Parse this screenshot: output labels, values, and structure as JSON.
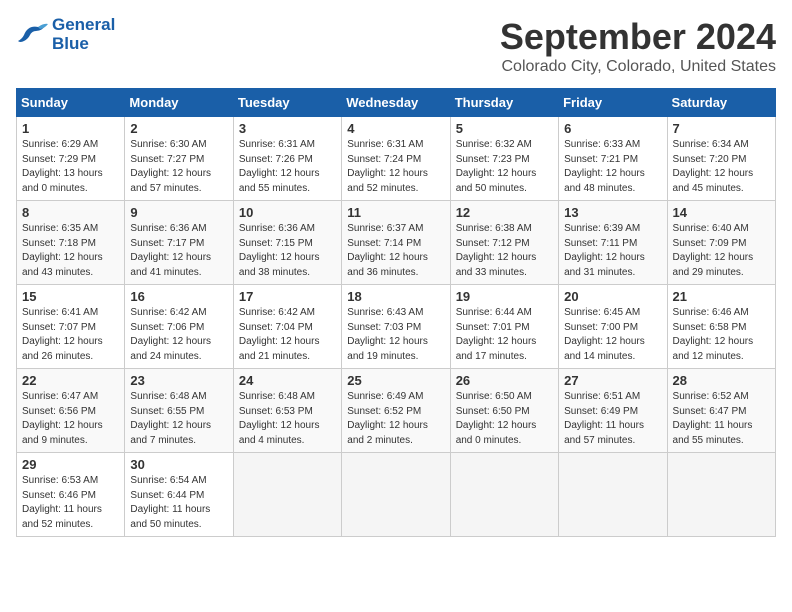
{
  "logo": {
    "line1": "General",
    "line2": "Blue"
  },
  "title": "September 2024",
  "location": "Colorado City, Colorado, United States",
  "days_of_week": [
    "Sunday",
    "Monday",
    "Tuesday",
    "Wednesday",
    "Thursday",
    "Friday",
    "Saturday"
  ],
  "weeks": [
    [
      {
        "day": "1",
        "info": "Sunrise: 6:29 AM\nSunset: 7:29 PM\nDaylight: 13 hours\nand 0 minutes."
      },
      {
        "day": "2",
        "info": "Sunrise: 6:30 AM\nSunset: 7:27 PM\nDaylight: 12 hours\nand 57 minutes."
      },
      {
        "day": "3",
        "info": "Sunrise: 6:31 AM\nSunset: 7:26 PM\nDaylight: 12 hours\nand 55 minutes."
      },
      {
        "day": "4",
        "info": "Sunrise: 6:31 AM\nSunset: 7:24 PM\nDaylight: 12 hours\nand 52 minutes."
      },
      {
        "day": "5",
        "info": "Sunrise: 6:32 AM\nSunset: 7:23 PM\nDaylight: 12 hours\nand 50 minutes."
      },
      {
        "day": "6",
        "info": "Sunrise: 6:33 AM\nSunset: 7:21 PM\nDaylight: 12 hours\nand 48 minutes."
      },
      {
        "day": "7",
        "info": "Sunrise: 6:34 AM\nSunset: 7:20 PM\nDaylight: 12 hours\nand 45 minutes."
      }
    ],
    [
      {
        "day": "8",
        "info": "Sunrise: 6:35 AM\nSunset: 7:18 PM\nDaylight: 12 hours\nand 43 minutes."
      },
      {
        "day": "9",
        "info": "Sunrise: 6:36 AM\nSunset: 7:17 PM\nDaylight: 12 hours\nand 41 minutes."
      },
      {
        "day": "10",
        "info": "Sunrise: 6:36 AM\nSunset: 7:15 PM\nDaylight: 12 hours\nand 38 minutes."
      },
      {
        "day": "11",
        "info": "Sunrise: 6:37 AM\nSunset: 7:14 PM\nDaylight: 12 hours\nand 36 minutes."
      },
      {
        "day": "12",
        "info": "Sunrise: 6:38 AM\nSunset: 7:12 PM\nDaylight: 12 hours\nand 33 minutes."
      },
      {
        "day": "13",
        "info": "Sunrise: 6:39 AM\nSunset: 7:11 PM\nDaylight: 12 hours\nand 31 minutes."
      },
      {
        "day": "14",
        "info": "Sunrise: 6:40 AM\nSunset: 7:09 PM\nDaylight: 12 hours\nand 29 minutes."
      }
    ],
    [
      {
        "day": "15",
        "info": "Sunrise: 6:41 AM\nSunset: 7:07 PM\nDaylight: 12 hours\nand 26 minutes."
      },
      {
        "day": "16",
        "info": "Sunrise: 6:42 AM\nSunset: 7:06 PM\nDaylight: 12 hours\nand 24 minutes."
      },
      {
        "day": "17",
        "info": "Sunrise: 6:42 AM\nSunset: 7:04 PM\nDaylight: 12 hours\nand 21 minutes."
      },
      {
        "day": "18",
        "info": "Sunrise: 6:43 AM\nSunset: 7:03 PM\nDaylight: 12 hours\nand 19 minutes."
      },
      {
        "day": "19",
        "info": "Sunrise: 6:44 AM\nSunset: 7:01 PM\nDaylight: 12 hours\nand 17 minutes."
      },
      {
        "day": "20",
        "info": "Sunrise: 6:45 AM\nSunset: 7:00 PM\nDaylight: 12 hours\nand 14 minutes."
      },
      {
        "day": "21",
        "info": "Sunrise: 6:46 AM\nSunset: 6:58 PM\nDaylight: 12 hours\nand 12 minutes."
      }
    ],
    [
      {
        "day": "22",
        "info": "Sunrise: 6:47 AM\nSunset: 6:56 PM\nDaylight: 12 hours\nand 9 minutes."
      },
      {
        "day": "23",
        "info": "Sunrise: 6:48 AM\nSunset: 6:55 PM\nDaylight: 12 hours\nand 7 minutes."
      },
      {
        "day": "24",
        "info": "Sunrise: 6:48 AM\nSunset: 6:53 PM\nDaylight: 12 hours\nand 4 minutes."
      },
      {
        "day": "25",
        "info": "Sunrise: 6:49 AM\nSunset: 6:52 PM\nDaylight: 12 hours\nand 2 minutes."
      },
      {
        "day": "26",
        "info": "Sunrise: 6:50 AM\nSunset: 6:50 PM\nDaylight: 12 hours\nand 0 minutes."
      },
      {
        "day": "27",
        "info": "Sunrise: 6:51 AM\nSunset: 6:49 PM\nDaylight: 11 hours\nand 57 minutes."
      },
      {
        "day": "28",
        "info": "Sunrise: 6:52 AM\nSunset: 6:47 PM\nDaylight: 11 hours\nand 55 minutes."
      }
    ],
    [
      {
        "day": "29",
        "info": "Sunrise: 6:53 AM\nSunset: 6:46 PM\nDaylight: 11 hours\nand 52 minutes."
      },
      {
        "day": "30",
        "info": "Sunrise: 6:54 AM\nSunset: 6:44 PM\nDaylight: 11 hours\nand 50 minutes."
      },
      {
        "day": "",
        "info": ""
      },
      {
        "day": "",
        "info": ""
      },
      {
        "day": "",
        "info": ""
      },
      {
        "day": "",
        "info": ""
      },
      {
        "day": "",
        "info": ""
      }
    ]
  ]
}
